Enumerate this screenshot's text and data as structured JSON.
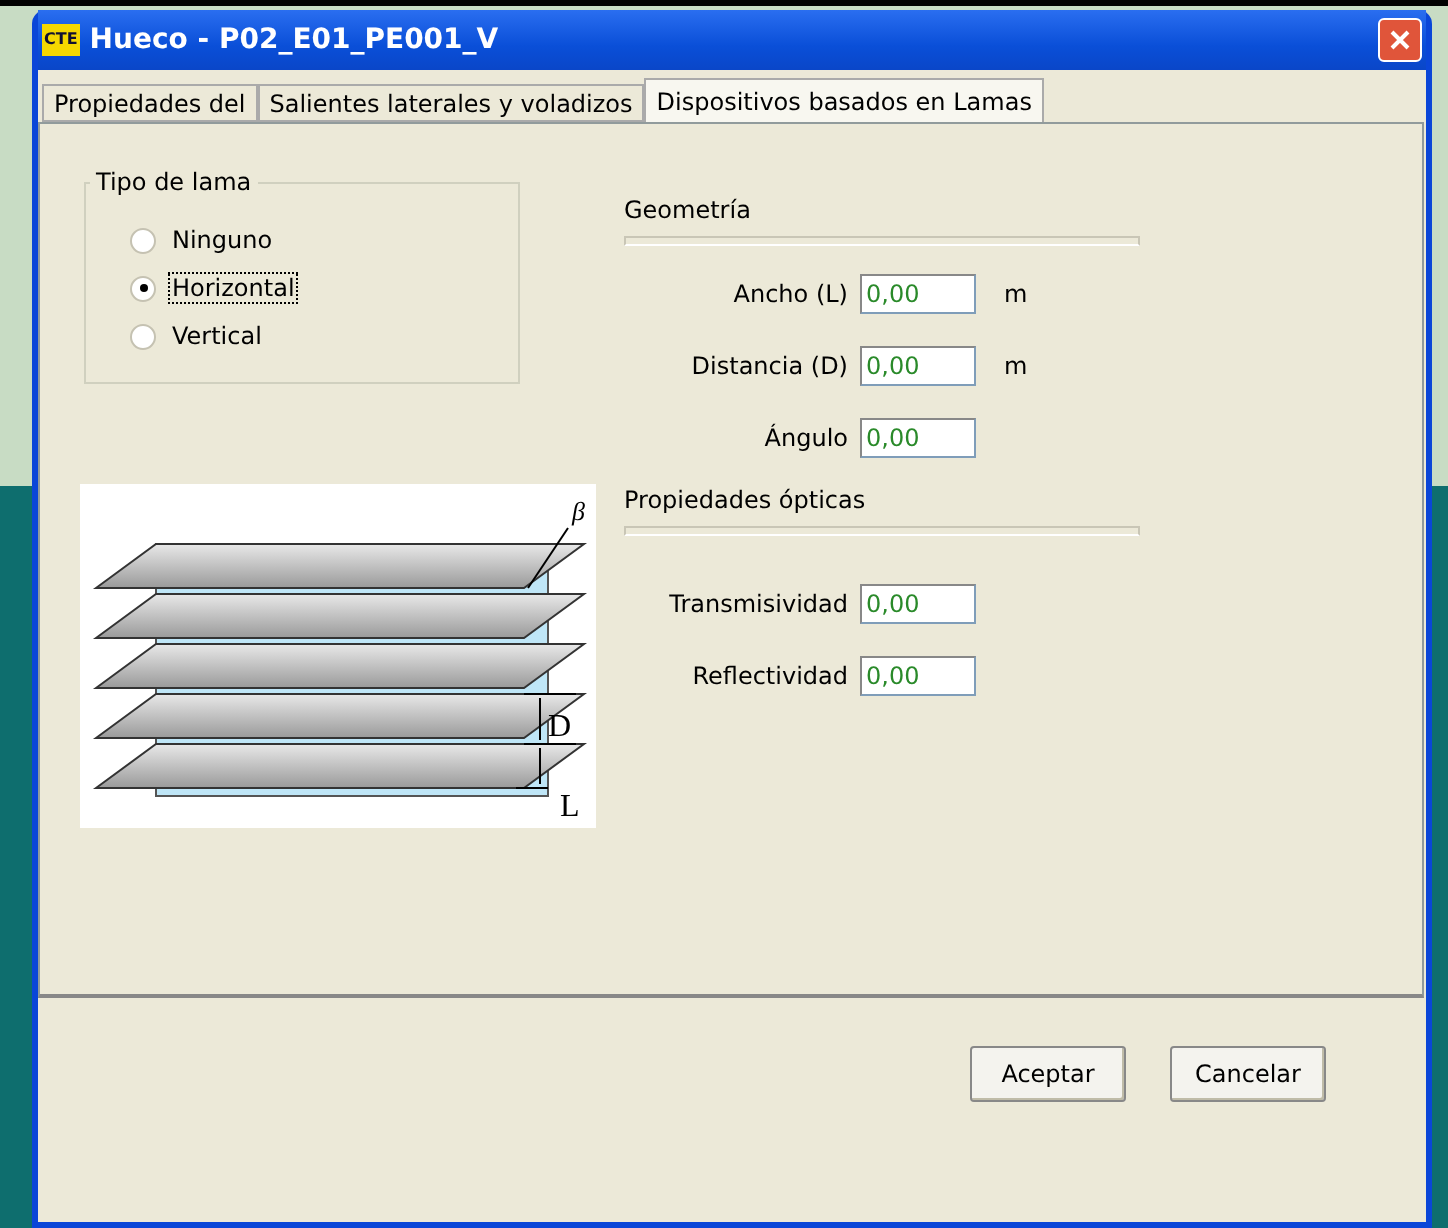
{
  "window": {
    "icon_text": "CTE",
    "title": "Hueco - P02_E01_PE001_V"
  },
  "tabs": [
    {
      "label": "Propiedades del",
      "selected": false
    },
    {
      "label": "Salientes laterales y voladizos",
      "selected": false
    },
    {
      "label": "Dispositivos basados en Lamas",
      "selected": true
    }
  ],
  "tipo_de_lama": {
    "title": "Tipo de lama",
    "options": [
      {
        "label": "Ninguno",
        "selected": false
      },
      {
        "label": "Horizontal",
        "selected": true
      },
      {
        "label": "Vertical",
        "selected": false
      }
    ]
  },
  "diagram": {
    "angle_label": "β",
    "spacing_label": "D",
    "width_label": "L"
  },
  "geometria": {
    "title": "Geometría",
    "fields": [
      {
        "label": "Ancho (L)",
        "value": "0,00",
        "unit": "m"
      },
      {
        "label": "Distancia (D)",
        "value": "0,00",
        "unit": "m"
      },
      {
        "label": "Ángulo",
        "value": "0,00"
      }
    ]
  },
  "propiedades_opticas": {
    "title": "Propiedades ópticas",
    "fields": [
      {
        "label": "Transmisividad",
        "value": "0,00"
      },
      {
        "label": "Reflectividad",
        "value": "0,00"
      }
    ]
  },
  "buttons": [
    "Aceptar",
    "Cancelar"
  ]
}
